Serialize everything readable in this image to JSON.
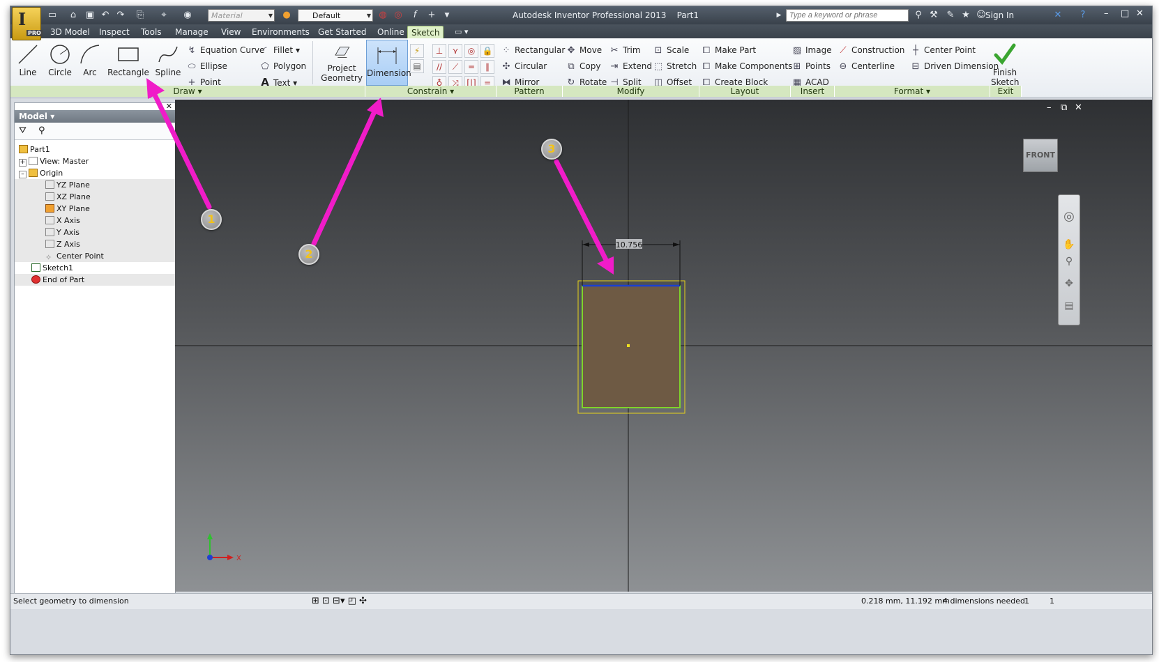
{
  "title_bar": {
    "app_title": "Autodesk Inventor Professional 2013",
    "document": "Part1",
    "material_placeholder": "Material",
    "appearance_value": "Default",
    "search_placeholder": "Type a keyword or phrase",
    "sign_in": "Sign In",
    "app_badge": "PRO"
  },
  "menu_tabs": [
    "3D Model",
    "Inspect",
    "Tools",
    "Manage",
    "View",
    "Environments",
    "Get Started",
    "Online",
    "Sketch"
  ],
  "active_tab": "Sketch",
  "ribbon": {
    "draw": {
      "big": [
        "Line",
        "Circle",
        "Arc",
        "Rectangle",
        "Spline"
      ],
      "small": [
        "Equation Curve",
        "Ellipse",
        "Point",
        "Fillet",
        "Polygon",
        "Text"
      ],
      "panel_label": "Draw"
    },
    "constrain": {
      "project_geometry": [
        "Project",
        "Geometry"
      ],
      "dimension": "Dimension",
      "panel_label": "Constrain"
    },
    "pattern": {
      "items": [
        "Rectangular",
        "Circular",
        "Mirror"
      ],
      "panel_label": "Pattern"
    },
    "modify": {
      "items": [
        "Move",
        "Copy",
        "Rotate",
        "Trim",
        "Extend",
        "Split",
        "Scale",
        "Stretch",
        "Offset"
      ],
      "panel_label": "Modify"
    },
    "layout": {
      "items": [
        "Make Part",
        "Make Components",
        "Create Block"
      ],
      "panel_label": "Layout"
    },
    "insert": {
      "items": [
        "Image",
        "Points",
        "ACAD"
      ],
      "panel_label": "Insert"
    },
    "format": {
      "items": [
        "Construction",
        "Centerline",
        "Center Point",
        "Driven Dimension"
      ],
      "panel_label": "Format"
    },
    "exit": {
      "finish": [
        "Finish",
        "Sketch"
      ],
      "panel_label": "Exit"
    }
  },
  "browser": {
    "header": "Model",
    "tree": [
      {
        "label": "Part1",
        "level": 0
      },
      {
        "label": "View: Master",
        "level": 1
      },
      {
        "label": "Origin",
        "level": 1
      },
      {
        "label": "YZ Plane",
        "level": 2
      },
      {
        "label": "XZ Plane",
        "level": 2
      },
      {
        "label": "XY Plane",
        "level": 2
      },
      {
        "label": "X Axis",
        "level": 2
      },
      {
        "label": "Y Axis",
        "level": 2
      },
      {
        "label": "Z Axis",
        "level": 2
      },
      {
        "label": "Center Point",
        "level": 2
      },
      {
        "label": "Sketch1",
        "level": 1
      },
      {
        "label": "End of Part",
        "level": 1
      }
    ]
  },
  "viewport": {
    "viewcube_label": "FRONT",
    "dimension_value": "10.756",
    "axis_x": "X"
  },
  "callouts": [
    "1",
    "2",
    "3"
  ],
  "status": {
    "prompt": "Select geometry to dimension",
    "coords": "0.218 mm, 11.192 mm",
    "dims_needed": "4 dimensions needed",
    "count_a": "1",
    "count_b": "1"
  },
  "colors": {
    "ribbon_panel_bar": "#d5e7c0",
    "active_tab": "#dff0c9",
    "rectangle_fill": "#6e5a44",
    "rectangle_edge": "#7fd42a",
    "selected_edge": "#1a3fd0",
    "selection_box": "#e8d31a",
    "arrow": "#f01cc8"
  }
}
